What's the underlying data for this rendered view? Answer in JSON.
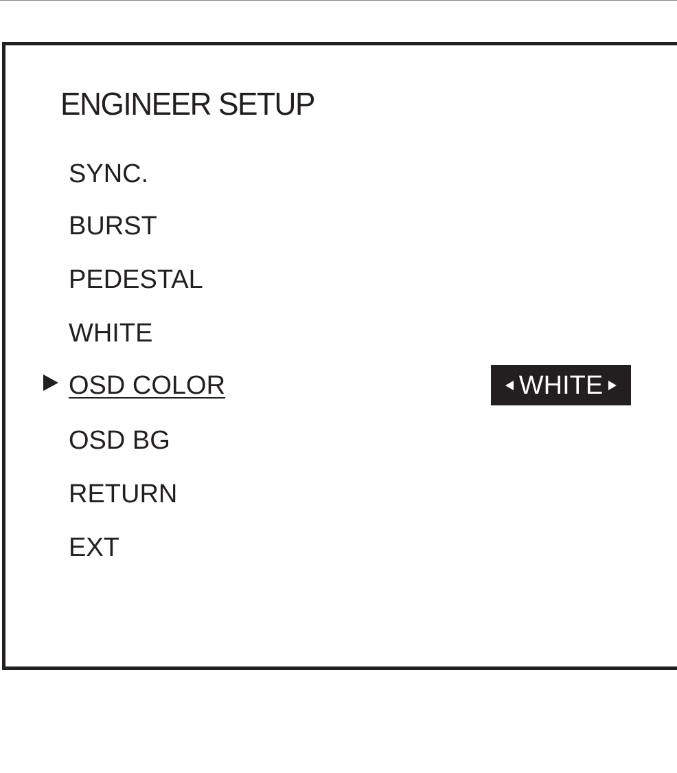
{
  "menu": {
    "title": "ENGINEER SETUP",
    "items": [
      {
        "label": "SYNC."
      },
      {
        "label": "BURST"
      },
      {
        "label": "PEDESTAL"
      },
      {
        "label": "WHITE"
      },
      {
        "label": "OSD COLOR"
      },
      {
        "label": "OSD BG"
      },
      {
        "label": "RETURN"
      },
      {
        "label": "EXT"
      }
    ],
    "selected_index": 4,
    "selected_value": "WHITE"
  },
  "icons": {
    "pointer": "pointer-icon",
    "value_left": "arrow-left-icon",
    "value_right": "arrow-right-icon"
  },
  "colors": {
    "foreground": "#231f20",
    "background": "#ffffff",
    "value_box_text": "#ffffff"
  }
}
